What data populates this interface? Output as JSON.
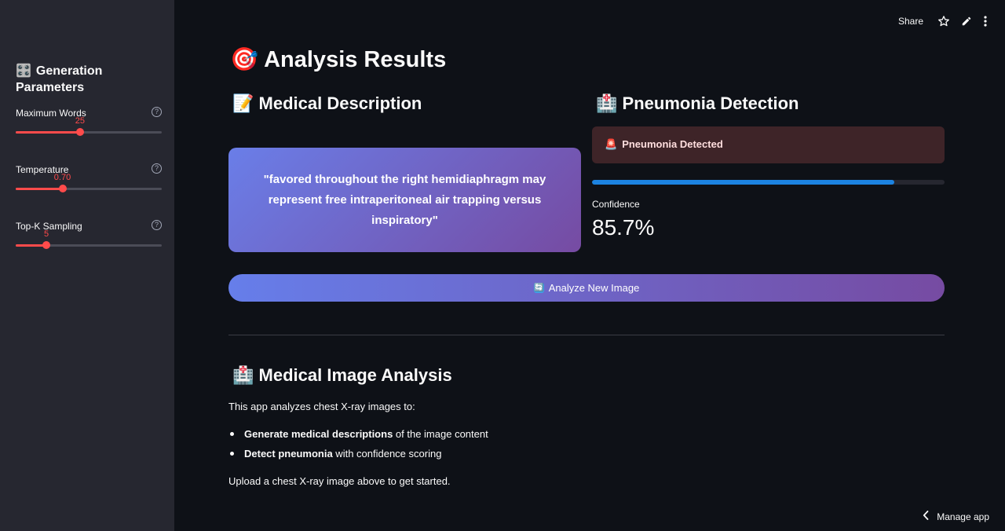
{
  "sidebar": {
    "title_emoji": "🎛️",
    "title": "Generation Parameters",
    "sliders": [
      {
        "label": "Maximum Words",
        "value": "25",
        "fraction": 0.44
      },
      {
        "label": "Temperature",
        "value": "0.70",
        "fraction": 0.32
      },
      {
        "label": "Top-K Sampling",
        "value": "5",
        "fraction": 0.21
      }
    ],
    "help_glyph": "?"
  },
  "topbar": {
    "share_label": "Share",
    "icons": [
      "star-icon",
      "edit-icon",
      "more-icon"
    ]
  },
  "main": {
    "title_emoji": "🎯",
    "title": "Analysis Results",
    "description_section": {
      "emoji": "📝",
      "heading": "Medical Description",
      "text": "\"favored throughout the right hemidiaphragm may represent free intraperitoneal air trapping versus inspiratory\""
    },
    "pneumonia_section": {
      "emoji": "🏥",
      "heading": "Pneumonia Detection",
      "alert_emoji": "🚨",
      "alert_text": "Pneumonia Detected",
      "alert_color": "#3e2428",
      "progress": 0.857,
      "progress_color": "#1c83e1",
      "confidence_label": "Confidence",
      "confidence_value": "85.7%"
    },
    "analyze_button": {
      "icon": "🔄",
      "label": "Analyze New Image"
    },
    "info_section": {
      "emoji": "🏥",
      "heading": "Medical Image Analysis",
      "intro": "This app analyzes chest X-ray images to:",
      "bullets": [
        {
          "bold": "Generate medical descriptions",
          "rest": " of the image content"
        },
        {
          "bold": "Detect pneumonia",
          "rest": " with confidence scoring"
        }
      ],
      "outro": "Upload a chest X-ray image above to get started."
    }
  },
  "footer": {
    "manage_label": "Manage app"
  },
  "colors": {
    "accent": "#ff4b4b",
    "background": "#0e1117",
    "sidebar": "#262730"
  }
}
